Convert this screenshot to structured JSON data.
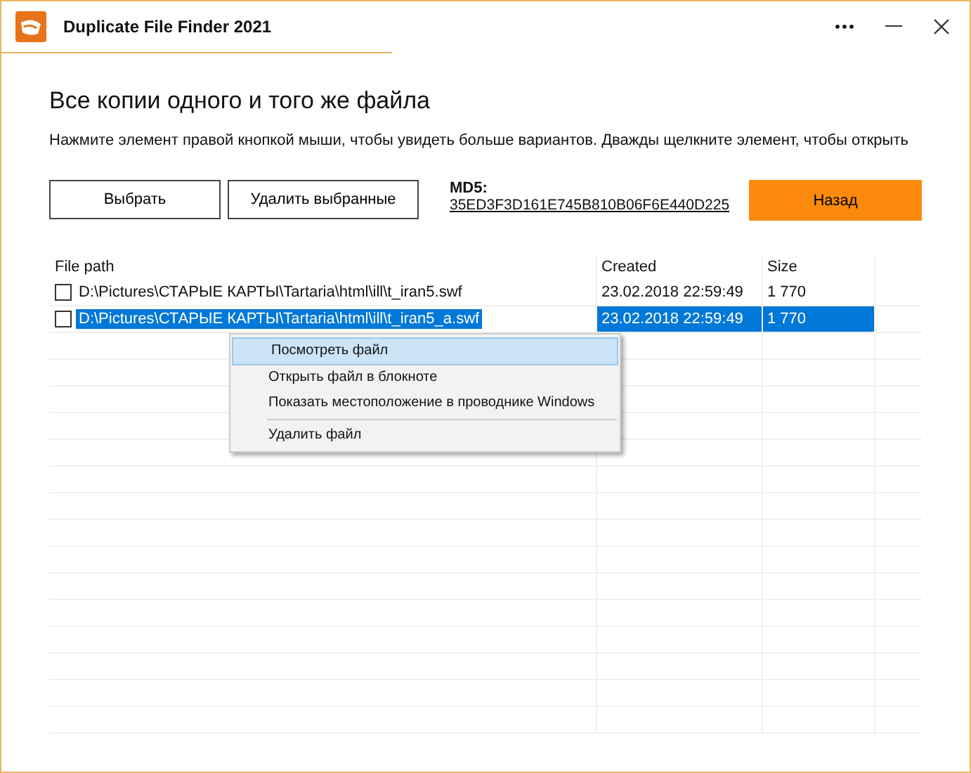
{
  "window": {
    "title": "Duplicate File Finder 2021"
  },
  "heading": "Все копии одного и того же файла",
  "hint": "Нажмите элемент правой кнопкой мыши, чтобы увидеть больше вариантов. Дважды щелкните элемент, чтобы открыть",
  "buttons": [
    "Выбрать",
    "Удалить выбранные"
  ],
  "md5": {
    "label": "MD5:",
    "value": "35ED3F3D161E745B810B06F6E440D225"
  },
  "back_button": "Назад",
  "table": {
    "columns": [
      "File path",
      "Created",
      "Size"
    ],
    "rows": [
      {
        "path": "D:\\Pictures\\СТАРЫЕ КАРТЫ\\Tartaria\\html\\ill\\t_iran5.swf",
        "created": "23.02.2018 22:59:49",
        "size": "1 770",
        "checked": false,
        "selected": false
      },
      {
        "path": "D:\\Pictures\\СТАРЫЕ КАРТЫ\\Tartaria\\html\\ill\\t_iran5_a.swf",
        "created": "23.02.2018 22:59:49",
        "size": "1 770",
        "checked": false,
        "selected": true
      }
    ]
  },
  "context_menu": [
    {
      "label": "Посмотреть файл",
      "selected": true,
      "separator_before": false
    },
    {
      "label": "Открыть файл в блокноте",
      "selected": false,
      "separator_before": false
    },
    {
      "label": "Показать местоположение в проводнике Windows",
      "selected": false,
      "separator_before": false
    },
    {
      "label": "Удалить файл",
      "selected": false,
      "separator_before": true
    }
  ]
}
